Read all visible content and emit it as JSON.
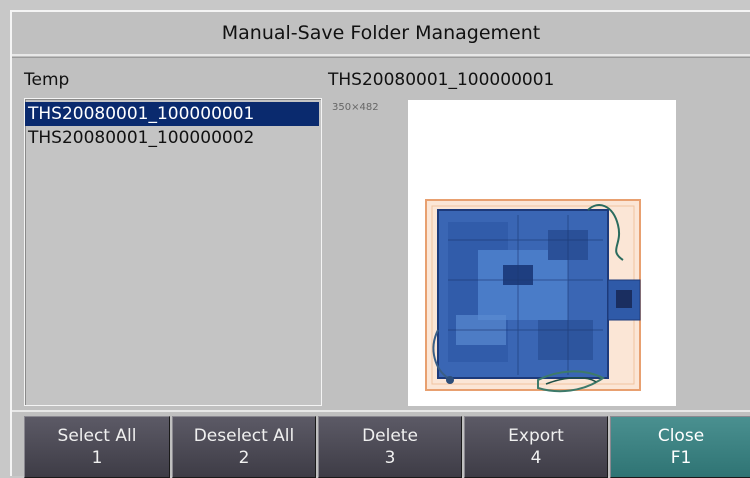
{
  "title": "Manual-Save Folder Management",
  "folder": {
    "name": "Temp"
  },
  "files": [
    {
      "name": "THS20080001_100000001",
      "selected": true
    },
    {
      "name": "THS20080001_100000002",
      "selected": false
    }
  ],
  "preview": {
    "title": "THS20080001_100000001",
    "dims": "350×482"
  },
  "buttons": [
    {
      "label": "Select All",
      "key": "1"
    },
    {
      "label": "Deselect All",
      "key": "2"
    },
    {
      "label": "Delete",
      "key": "3"
    },
    {
      "label": "Export",
      "key": "4"
    },
    {
      "label": "Close",
      "key": "F1"
    }
  ],
  "colors": {
    "selection": "#0a2a6e",
    "button": "#4a4852",
    "close_button": "#3a8080"
  }
}
